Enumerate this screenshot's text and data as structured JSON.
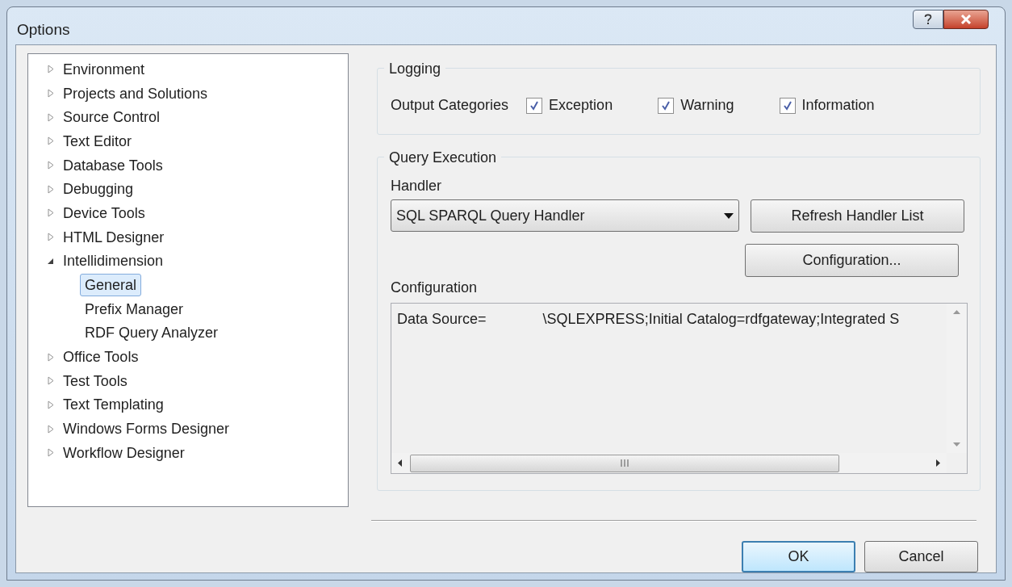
{
  "window": {
    "title": "Options"
  },
  "tree": [
    {
      "label": "Environment",
      "expanded": false,
      "selected": false
    },
    {
      "label": "Projects and Solutions",
      "expanded": false,
      "selected": false
    },
    {
      "label": "Source Control",
      "expanded": false,
      "selected": false
    },
    {
      "label": "Text Editor",
      "expanded": false,
      "selected": false
    },
    {
      "label": "Database Tools",
      "expanded": false,
      "selected": false
    },
    {
      "label": "Debugging",
      "expanded": false,
      "selected": false
    },
    {
      "label": "Device Tools",
      "expanded": false,
      "selected": false
    },
    {
      "label": "HTML Designer",
      "expanded": false,
      "selected": false
    },
    {
      "label": "Intellidimension",
      "expanded": true,
      "selected": false,
      "children": [
        {
          "label": "General",
          "selected": true
        },
        {
          "label": "Prefix Manager",
          "selected": false
        },
        {
          "label": "RDF Query Analyzer",
          "selected": false
        }
      ]
    },
    {
      "label": "Office Tools",
      "expanded": false,
      "selected": false
    },
    {
      "label": "Test Tools",
      "expanded": false,
      "selected": false
    },
    {
      "label": "Text Templating",
      "expanded": false,
      "selected": false
    },
    {
      "label": "Windows Forms Designer",
      "expanded": false,
      "selected": false
    },
    {
      "label": "Workflow Designer",
      "expanded": false,
      "selected": false
    }
  ],
  "logging": {
    "title": "Logging",
    "label": "Output Categories",
    "categories": [
      {
        "label": "Exception",
        "checked": true
      },
      {
        "label": "Warning",
        "checked": true
      },
      {
        "label": "Information",
        "checked": true
      }
    ]
  },
  "query_execution": {
    "title": "Query Execution",
    "handler_label": "Handler",
    "handler_value": "SQL SPARQL Query Handler",
    "refresh_button": "Refresh Handler List",
    "configuration_button": "Configuration...",
    "configuration_label": "Configuration",
    "configuration_value": "Data Source=              \\SQLEXPRESS;Initial Catalog=rdfgateway;Integrated S"
  },
  "buttons": [
    {
      "label": "OK",
      "default": true
    },
    {
      "label": "Cancel",
      "default": false
    }
  ]
}
